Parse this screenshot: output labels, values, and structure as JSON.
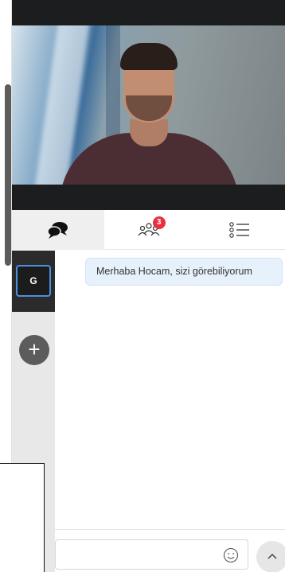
{
  "video": {
    "participant_view": "webcam-feed"
  },
  "tabs": [
    {
      "name": "chat",
      "icon": "chat-bubbles-icon",
      "active": true
    },
    {
      "name": "participants",
      "icon": "participants-icon",
      "badge": "3",
      "active": false
    },
    {
      "name": "list",
      "icon": "list-icon",
      "active": false
    }
  ],
  "conversations": [
    {
      "initial": "G",
      "selected": true
    }
  ],
  "messages": [
    {
      "text": "Merhaba Hocam, sizi görebiliyorum"
    }
  ],
  "colors": {
    "dark_bar": "#1c1d1f",
    "badge": "#e8303e",
    "bubble": "#e6f1fb",
    "selected_border": "#4a90e2"
  },
  "icons": {
    "add": "plus-icon",
    "emoji": "smiley-icon",
    "scroll_up": "chevron-up-icon"
  }
}
